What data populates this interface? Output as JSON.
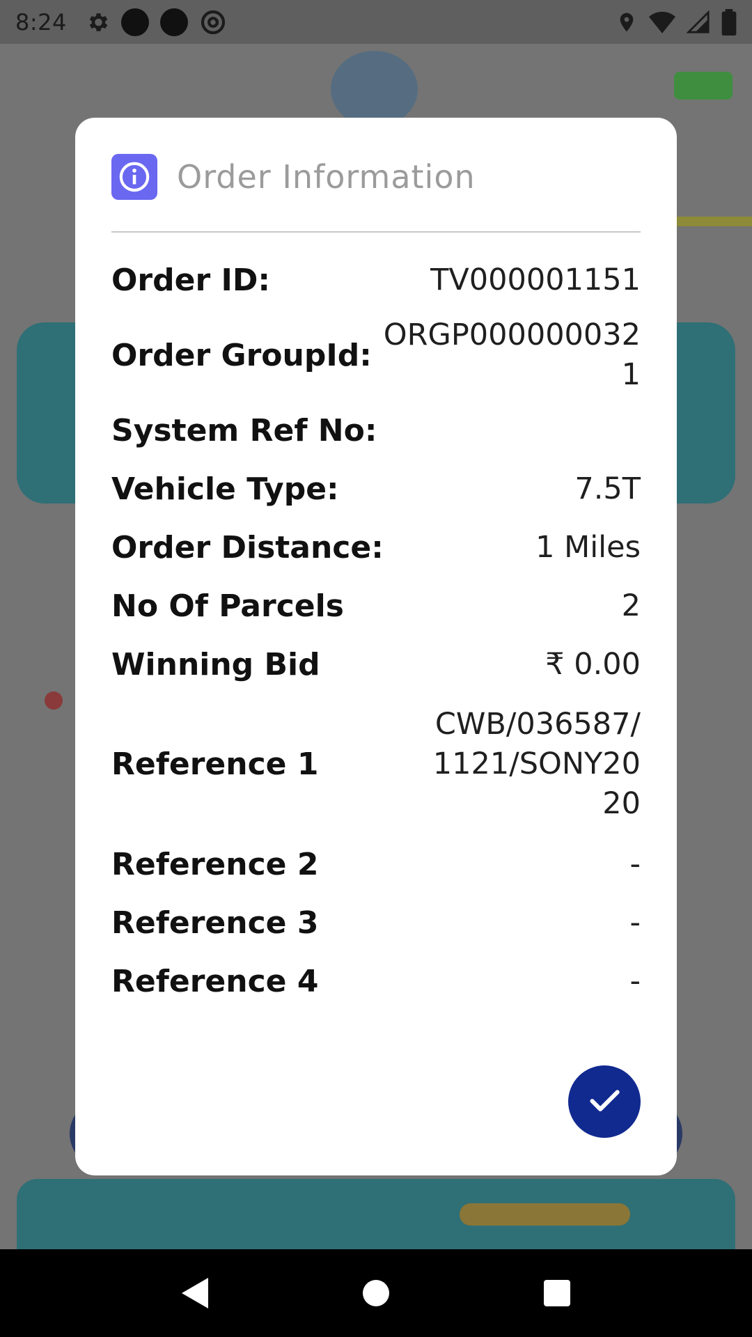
{
  "status_bar": {
    "time": "8:24",
    "left_icons": [
      "settings-icon",
      "notification-dot-icon",
      "notification-dot-icon",
      "at-sign-icon"
    ],
    "right_icons": [
      "location-icon",
      "wifi-icon",
      "signal-icon",
      "battery-icon"
    ]
  },
  "dialog": {
    "title": "Order Information",
    "icon": "info-icon",
    "accent_color": "#6a67f1",
    "rows": [
      {
        "label": "Order ID:",
        "value": "TV000001151"
      },
      {
        "label": "Order GroupId:",
        "value": "ORGP0000000321"
      },
      {
        "label": "System Ref No:",
        "value": ""
      },
      {
        "label": "Vehicle Type:",
        "value": "7.5T"
      },
      {
        "label": "Order Distance:",
        "value": "1 Miles"
      },
      {
        "label": "No Of Parcels",
        "value": "2"
      },
      {
        "label": "Winning Bid",
        "value": "₹ 0.00"
      },
      {
        "label": "Reference 1",
        "value": "CWB/036587/1121/SONY2020"
      },
      {
        "label": "Reference 2",
        "value": "-"
      },
      {
        "label": "Reference 3",
        "value": "-"
      },
      {
        "label": "Reference 4",
        "value": "-"
      }
    ],
    "confirm_button": {
      "icon": "check-icon",
      "color": "#112a8f"
    }
  },
  "nav_bar": {
    "buttons": [
      "back-icon",
      "home-icon",
      "recents-icon"
    ]
  }
}
